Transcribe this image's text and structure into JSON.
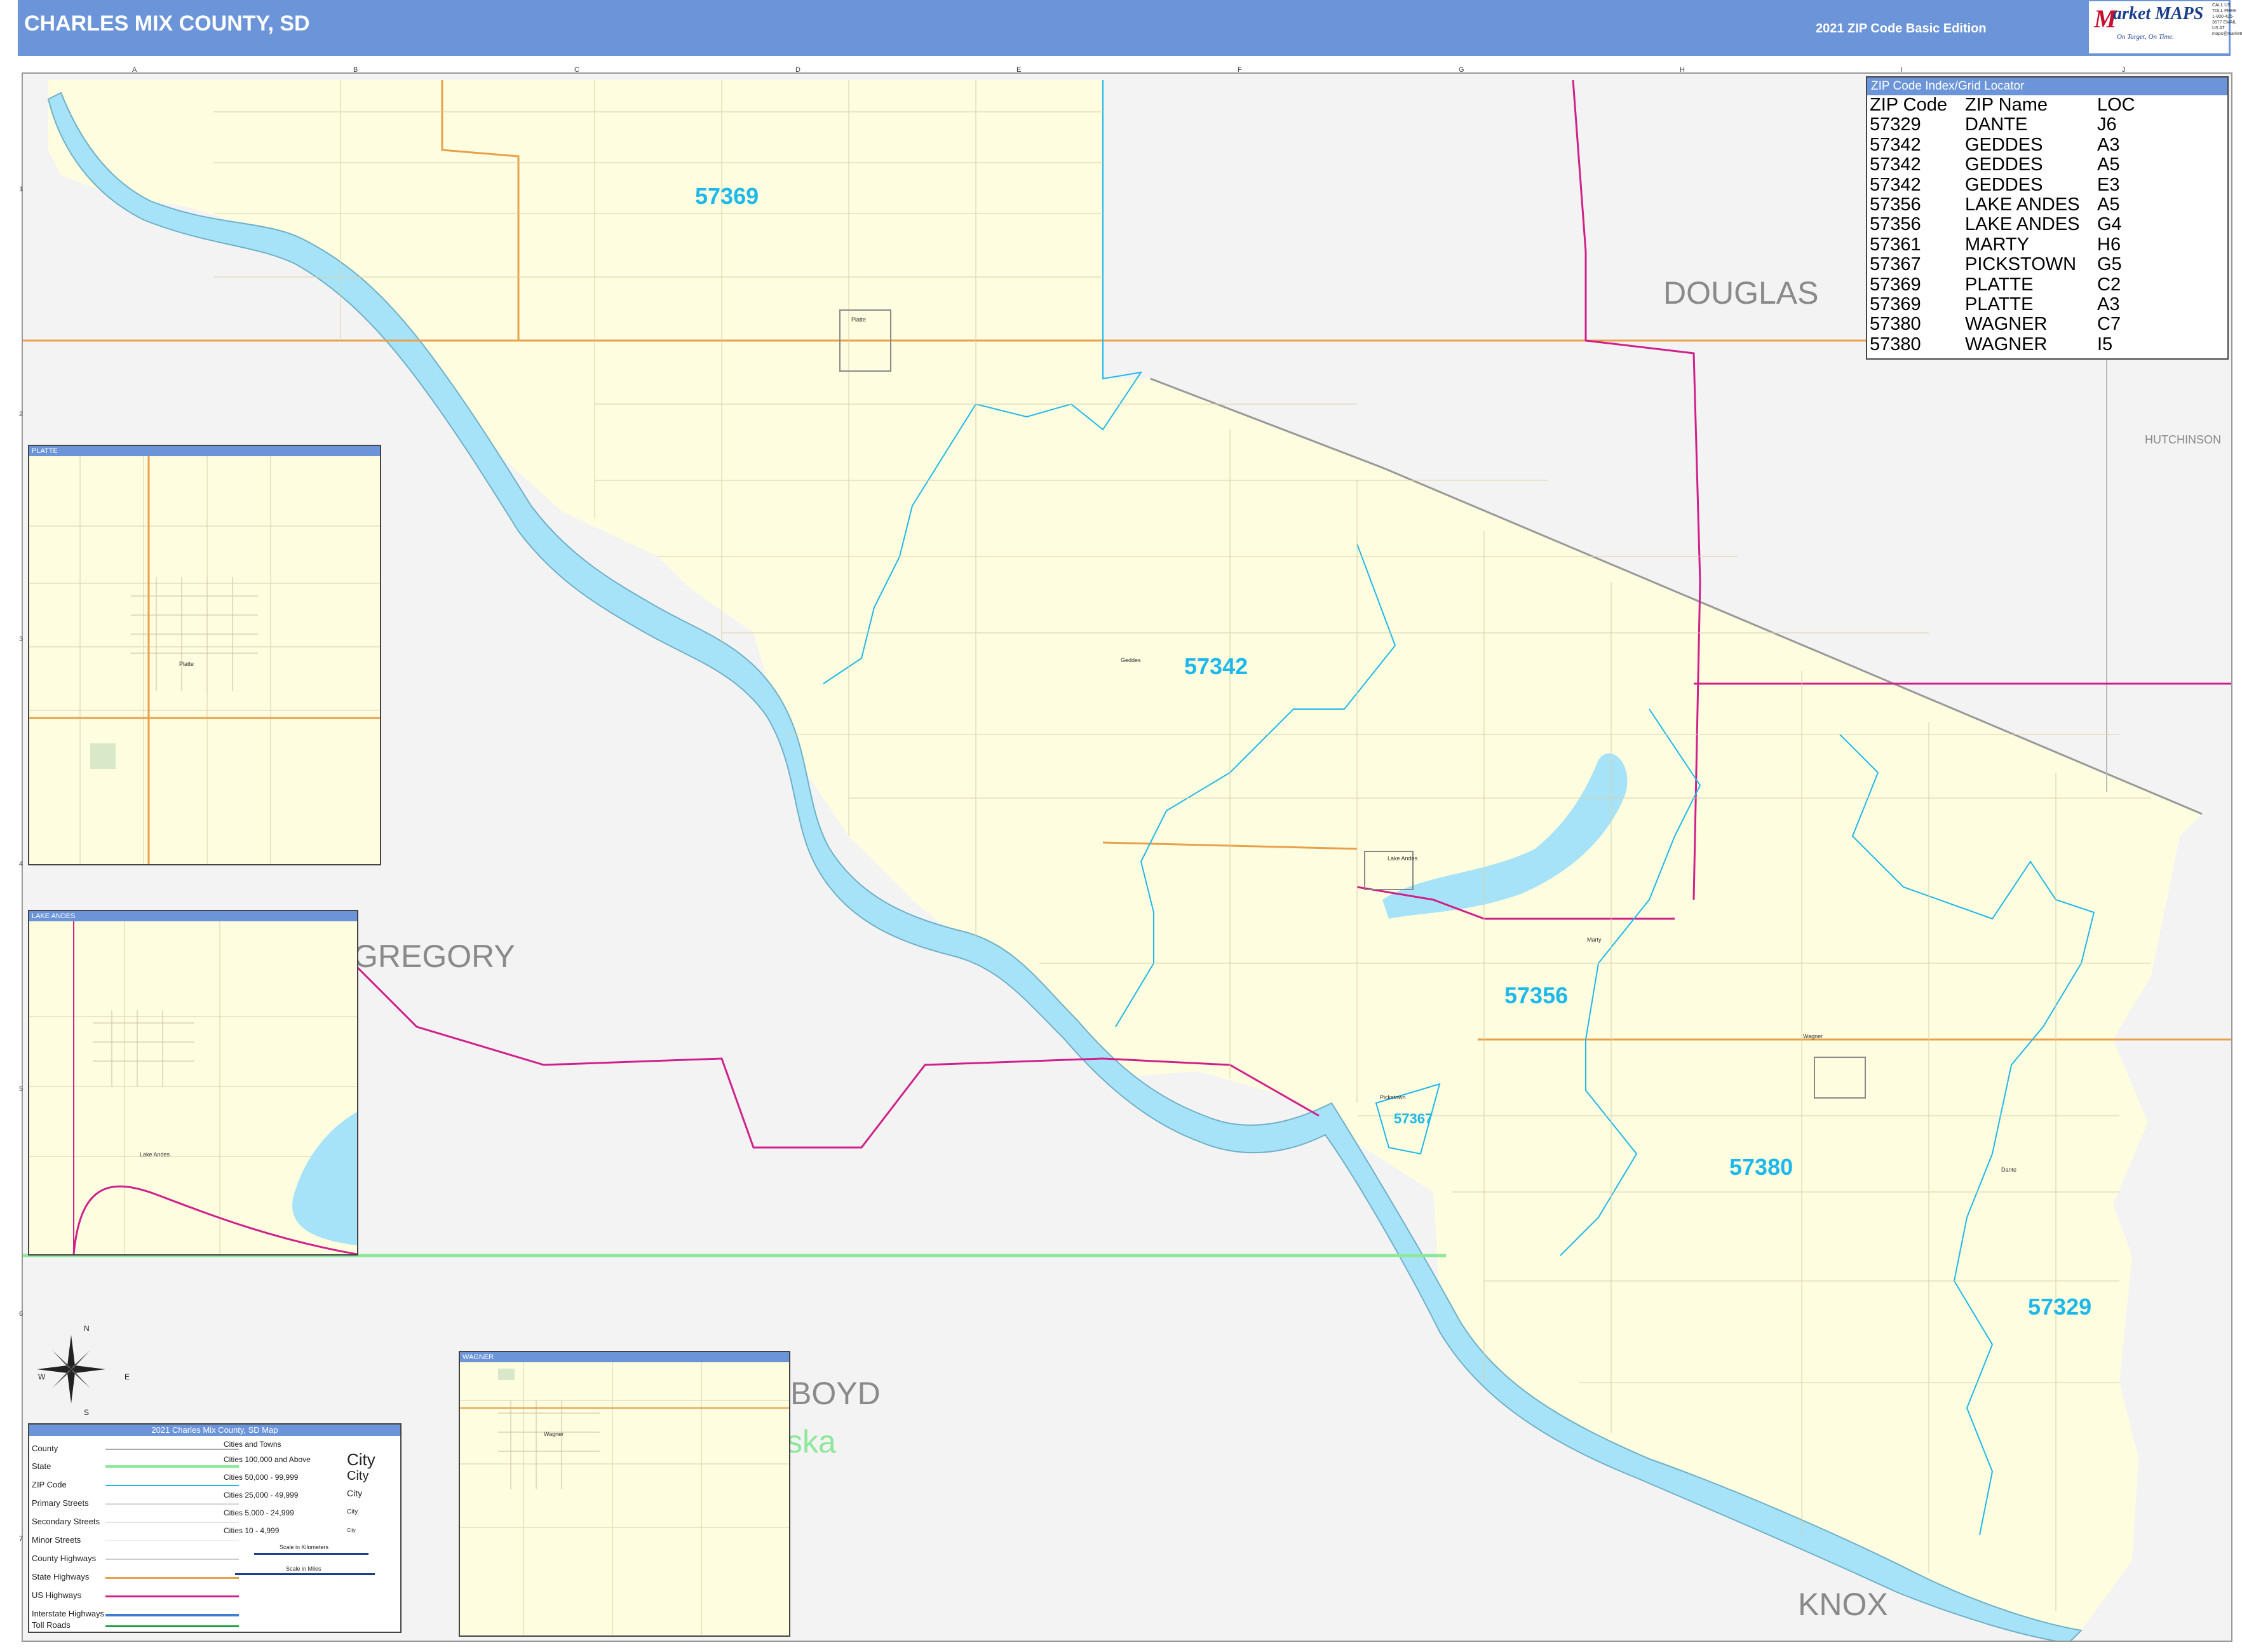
{
  "header": {
    "title": "CHARLES MIX COUNTY, SD",
    "edition": "2021 ZIP Code Basic Edition",
    "logo_m": "M",
    "logo_word": "arket MAPS",
    "logo_tagline": "On Target, On Time.",
    "contact": "CALL US TOLL FREE 1-800-425-3677 EMAIL US AT maps@marketmaps.com"
  },
  "grid": {
    "letters": [
      "A",
      "B",
      "C",
      "D",
      "E",
      "F",
      "G",
      "H",
      "I",
      "J"
    ],
    "numbers": [
      "1",
      "2",
      "3",
      "4",
      "5",
      "6",
      "7"
    ]
  },
  "zip_index": {
    "title": "ZIP Code Index/Grid Locator",
    "headers": [
      "ZIP Code",
      "ZIP Name",
      "LOC"
    ],
    "rows": [
      [
        "57329",
        "DANTE",
        "J6"
      ],
      [
        "57342",
        "GEDDES",
        "A3"
      ],
      [
        "57342",
        "GEDDES",
        "A5"
      ],
      [
        "57342",
        "GEDDES",
        "E3"
      ],
      [
        "57356",
        "LAKE ANDES",
        "A5"
      ],
      [
        "57356",
        "LAKE ANDES",
        "G4"
      ],
      [
        "57361",
        "MARTY",
        "H6"
      ],
      [
        "57367",
        "PICKSTOWN",
        "G5"
      ],
      [
        "57369",
        "PLATTE",
        "C2"
      ],
      [
        "57369",
        "PLATTE",
        "A3"
      ],
      [
        "57380",
        "WAGNER",
        "C7"
      ],
      [
        "57380",
        "WAGNER",
        "I5"
      ]
    ]
  },
  "counties": {
    "douglas": "DOUGLAS",
    "hutchinson": "HUTCHINSON",
    "gregory": "GREGORY",
    "boyd": "BOYD",
    "knox": "KNOX",
    "nebraska": "ska"
  },
  "zips": {
    "z57369": "57369",
    "z57342": "57342",
    "z57356": "57356",
    "z57367": "57367",
    "z57380": "57380",
    "z57329": "57329"
  },
  "places": {
    "platte": "Platte",
    "geddes": "Geddes",
    "lake_andes": "Lake Andes",
    "wagner": "Wagner",
    "marty": "Marty",
    "pickstown": "Pickstown",
    "dante": "Dante"
  },
  "insets": {
    "platte": "PLATTE",
    "lake_andes": "LAKE ANDES",
    "wagner": "WAGNER",
    "platte_town": "Platte",
    "lake_andes_town": "Lake Andes",
    "wagner_town": "Wagner"
  },
  "legend": {
    "title": "2021 Charles Mix County, SD Map",
    "items": [
      "County",
      "State",
      "ZIP Code",
      "Primary Streets",
      "Secondary Streets",
      "Minor Streets",
      "County Highways",
      "State Highways",
      "US Highways",
      "Interstate Highways",
      "Toll Roads"
    ],
    "cities_header": "Cities and Towns",
    "cities": [
      "Cities 100,000 and Above",
      "Cities 50,000 - 99,999",
      "Cities 25,000 - 49,999",
      "Cities 5,000 - 24,999",
      "Cities 10 - 4,999"
    ],
    "city_samples": [
      "City",
      "City",
      "City",
      "City",
      "City"
    ],
    "scale_km": "Scale in Kilometers",
    "scale_mi": "Scale in Miles"
  },
  "compass": {
    "n": "N",
    "s": "S",
    "e": "E",
    "w": "W"
  },
  "colors": {
    "header": "#6b95d8",
    "county_fill": "#fefde0",
    "outside_fill": "#f3f3f3",
    "water": "#a6e3f8",
    "zip_line": "#1fb8ea",
    "state_hwy": "#e8a04a",
    "us_hwy": "#d0208a",
    "state_line": "#8ee89a"
  }
}
